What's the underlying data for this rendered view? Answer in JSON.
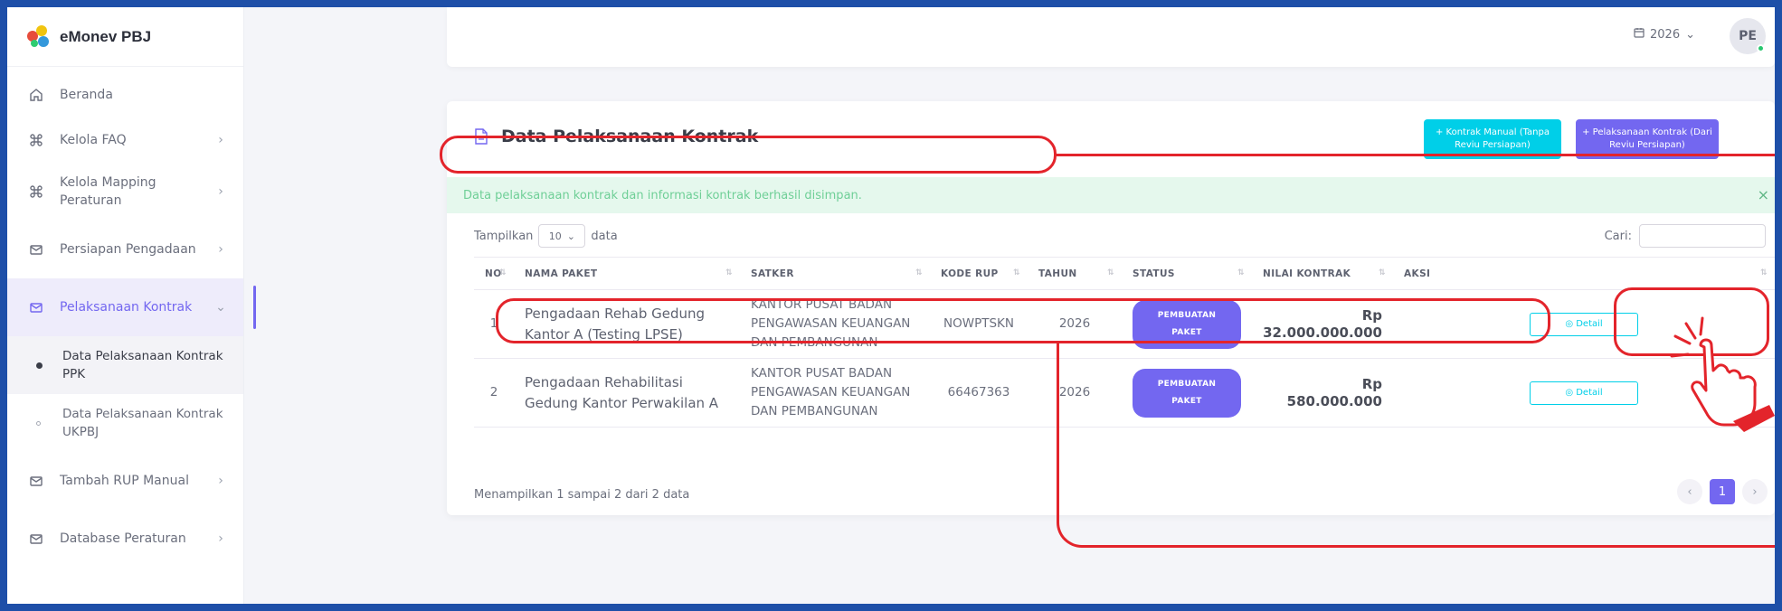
{
  "app": {
    "name": "eMonev PBJ"
  },
  "sidebar": {
    "items": [
      {
        "label": "Beranda",
        "icon": "home-icon"
      },
      {
        "label": "Kelola FAQ",
        "icon": "command-icon",
        "chevron": "›"
      },
      {
        "label": "Kelola Mapping Peraturan",
        "icon": "command-icon",
        "chevron": "›"
      },
      {
        "label": "Persiapan Pengadaan",
        "icon": "mail-icon",
        "chevron": "›"
      },
      {
        "label": "Pelaksanaan Kontrak",
        "icon": "mail-icon",
        "chevron": "⌄"
      },
      {
        "label": "Data Pelaksanaan Kontrak PPK"
      },
      {
        "label": "Data Pelaksanaan Kontrak UKPBJ"
      },
      {
        "label": "Tambah RUP Manual",
        "icon": "mail-icon",
        "chevron": "›"
      },
      {
        "label": "Database Peraturan",
        "icon": "mail-icon",
        "chevron": "›"
      }
    ]
  },
  "header": {
    "year": "2026",
    "year_chevron": "⌄",
    "avatar_initials": "PE"
  },
  "card": {
    "title": "Data Pelaksanaan Kontrak",
    "btn_manual": "+ Kontrak Manual (Tanpa Reviu Persiapan)",
    "btn_pelaksanaan": "+ Pelaksanaan Kontrak (Dari Reviu Persiapan)",
    "alert": "Data pelaksanaan kontrak dan informasi kontrak berhasil disimpan.",
    "alert_close": "×",
    "length_prefix": "Tampilkan",
    "length_value": "10",
    "length_suffix": "data",
    "search_label": "Cari:",
    "info": "Menampilkan 1 sampai 2 dari 2 data",
    "pager": {
      "prev": "‹",
      "current": "1",
      "next": "›"
    }
  },
  "table": {
    "headers": [
      "NO",
      "NAMA PAKET",
      "SATKER",
      "KODE RUP",
      "TAHUN",
      "STATUS",
      "NILAI KONTRAK",
      "AKSI"
    ],
    "rows": [
      {
        "no": "1",
        "nama_paket": "Pengadaan Rehab Gedung Kantor A (Testing LPSE)",
        "satker": "KANTOR PUSAT BADAN PENGAWASAN KEUANGAN DAN PEMBANGUNAN",
        "kode_rup": "NOWPTSKN",
        "tahun": "2026",
        "status": "PEMBUATAN PAKET",
        "nilai": "Rp 32.000.000.000",
        "aksi": "◎ Detail"
      },
      {
        "no": "2",
        "nama_paket": "Pengadaan Rehabilitasi Gedung Kantor Perwakilan A",
        "satker": "KANTOR PUSAT BADAN PENGAWASAN KEUANGAN DAN PEMBANGUNAN",
        "kode_rup": "66467363",
        "tahun": "2026",
        "status": "PEMBUATAN PAKET",
        "nilai": "Rp 580.000.000",
        "aksi": "◎ Detail"
      }
    ]
  },
  "colors": {
    "primary": "#7367f0",
    "info": "#00cfe8",
    "success_bg": "#e5f8ed",
    "annotation": "#e3242b",
    "frame": "#1e4fa8"
  }
}
